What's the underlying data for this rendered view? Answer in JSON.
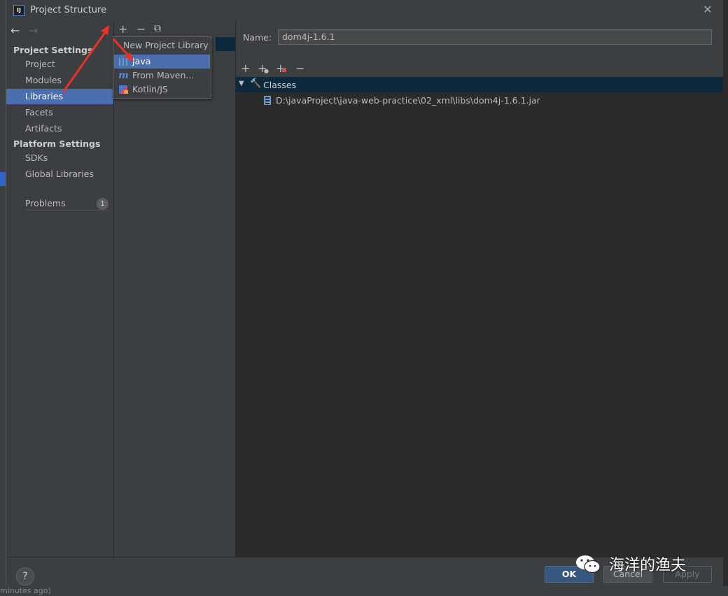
{
  "window": {
    "title": "Project Structure",
    "app_icon_text": "IJ"
  },
  "nav": {
    "back_icon": "←",
    "forward_icon": "→",
    "project_settings_header": "Project Settings",
    "project_settings_items": [
      {
        "label": "Project",
        "selected": false
      },
      {
        "label": "Modules",
        "selected": false
      },
      {
        "label": "Libraries",
        "selected": true
      },
      {
        "label": "Facets",
        "selected": false
      },
      {
        "label": "Artifacts",
        "selected": false
      }
    ],
    "platform_settings_header": "Platform Settings",
    "platform_settings_items": [
      {
        "label": "SDKs"
      },
      {
        "label": "Global Libraries"
      }
    ],
    "problems_label": "Problems",
    "problems_count": "1"
  },
  "middle_toolbar": {
    "add_icon": "+",
    "remove_icon": "−",
    "copy_icon": "⧉"
  },
  "popup": {
    "title": "New Project Library",
    "items": [
      {
        "label": "Java",
        "icon": "java-library-icon",
        "selected": true
      },
      {
        "label": "From Maven...",
        "icon": "maven-icon",
        "selected": false
      },
      {
        "label": "Kotlin/JS",
        "icon": "kotlin-icon",
        "selected": false
      }
    ]
  },
  "library": {
    "name_label": "Name:",
    "name_value": "dom4j-1.6.1",
    "classes_label": "Classes",
    "jar_path": "D:\\javaProject\\java-web-practice\\02_xml\\libs\\dom4j-1.6.1.jar"
  },
  "right_toolbar": {
    "add_icon": "+",
    "add_alt_icon": "+",
    "add_jar_icon": "+",
    "remove_icon": "−"
  },
  "footer": {
    "help_label": "?",
    "ok_label": "OK",
    "cancel_label": "Cancel",
    "apply_label": "Apply"
  },
  "watermark": {
    "text": "海洋的渔夫"
  },
  "background": {
    "bottom_text": "minutes ago)"
  },
  "colors": {
    "selection": "#4b6eaf",
    "accent_arrow": "#e8322a",
    "ok_button": "#365880"
  }
}
